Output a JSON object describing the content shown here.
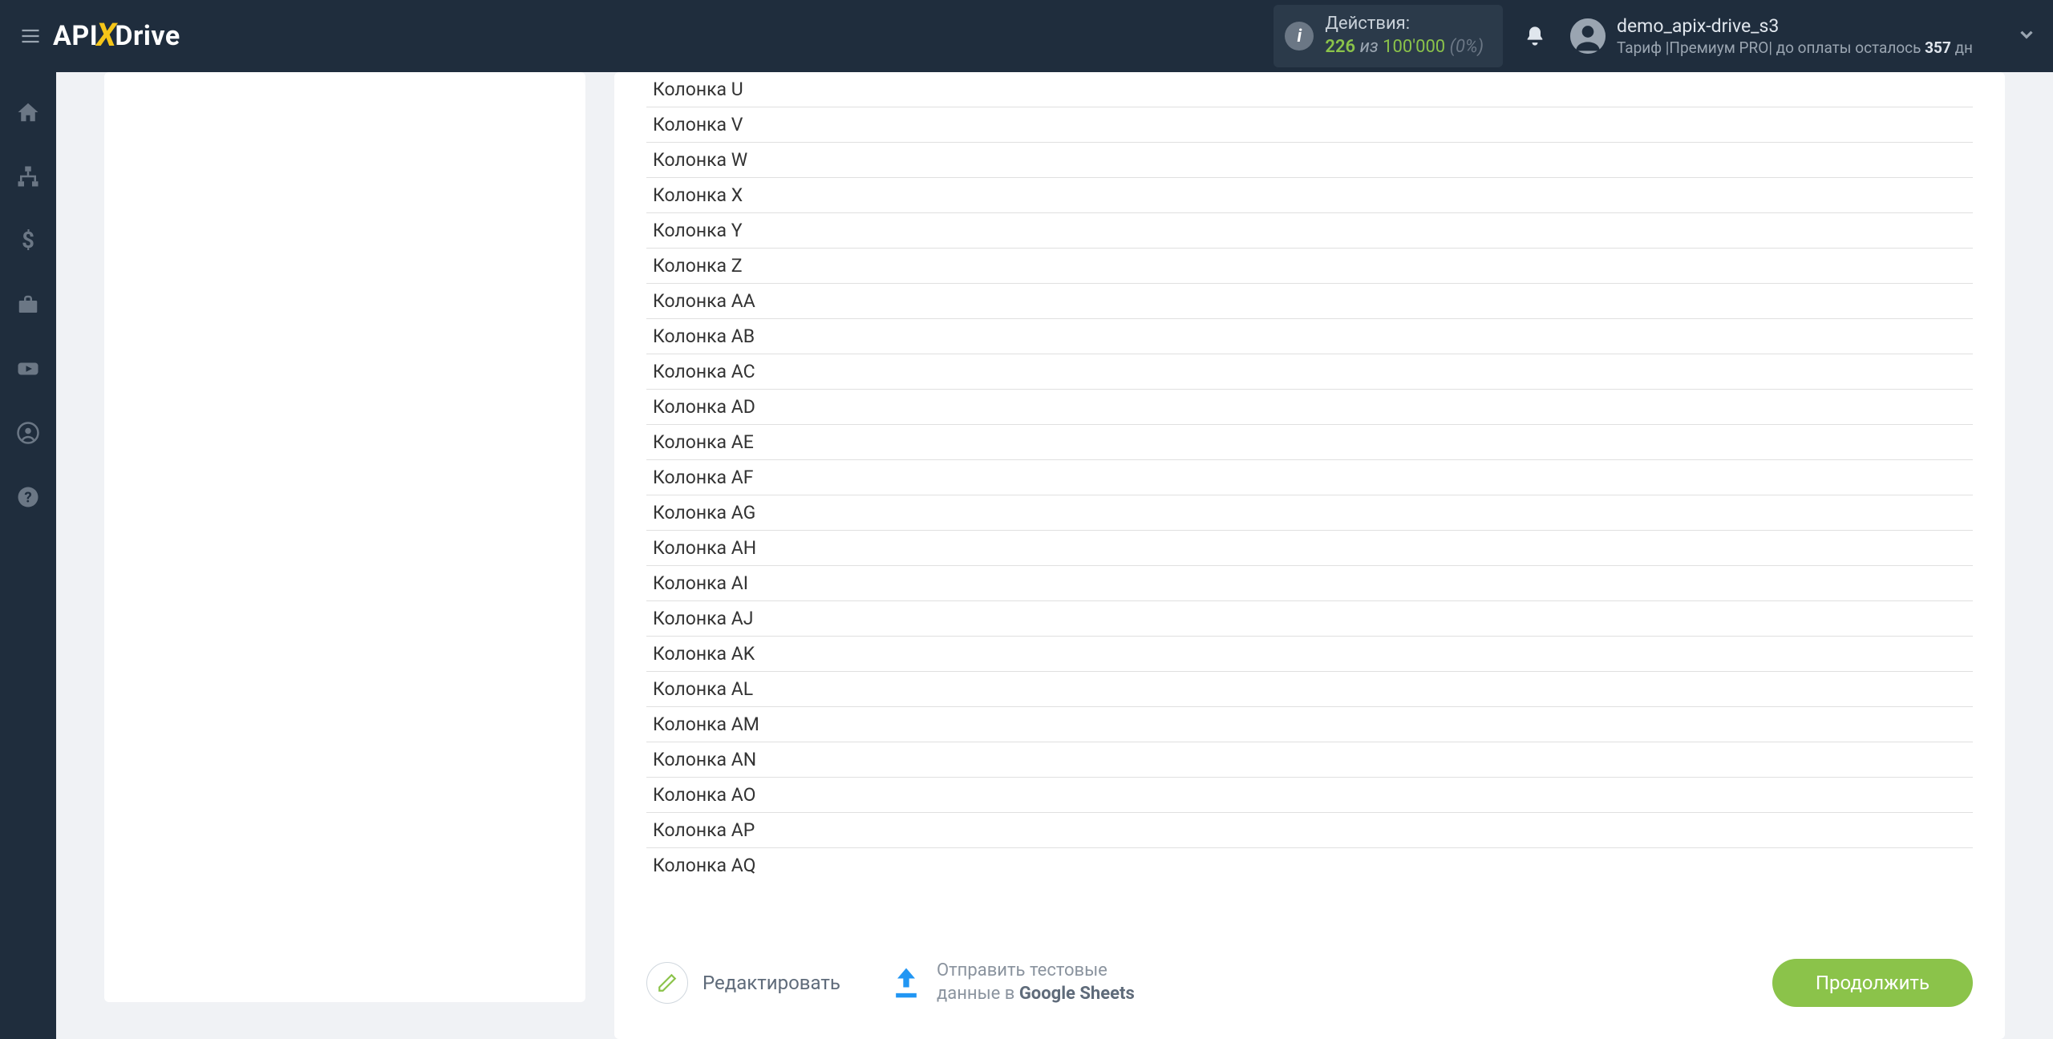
{
  "header": {
    "actions_label": "Действия:",
    "used": "226",
    "of_word": "из",
    "total": "100'000",
    "pct": "(0%)",
    "username": "demo_apix-drive_s3",
    "tariff_prefix": "Тариф |Премиум PRO| до оплаты осталось ",
    "days_num": "357",
    "days_suffix": " дн"
  },
  "columns": [
    "Колонка U",
    "Колонка V",
    "Колонка W",
    "Колонка X",
    "Колонка Y",
    "Колонка Z",
    "Колонка AA",
    "Колонка AB",
    "Колонка AC",
    "Колонка AD",
    "Колонка AE",
    "Колонка AF",
    "Колонка AG",
    "Колонка AH",
    "Колонка AI",
    "Колонка AJ",
    "Колонка AK",
    "Колонка AL",
    "Колонка AM",
    "Колонка AN",
    "Колонка AO",
    "Колонка AP",
    "Колонка AQ"
  ],
  "footer": {
    "edit_label": "Редактировать",
    "send_line1": "Отправить тестовые",
    "send_line2_prefix": "данные в ",
    "send_line2_bold": "Google Sheets",
    "continue_label": "Продолжить"
  }
}
